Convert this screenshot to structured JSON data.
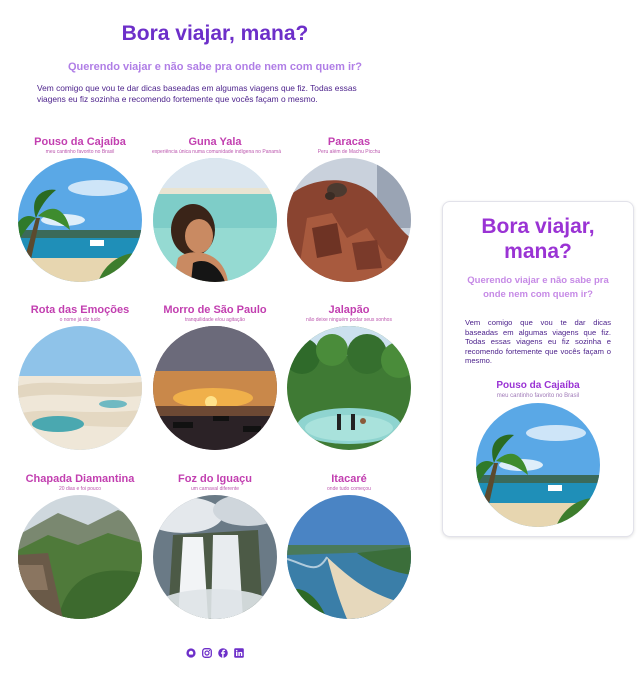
{
  "hero": {
    "title": "Bora viajar, mana?",
    "subtitle": "Querendo viajar e não sabe pra onde nem com quem ir?",
    "description": "Vem comigo que vou te dar dicas baseadas em algumas viagens que fiz. Todas essas viagens eu fiz sozinha e recomendo fortemente que vocês façam o mesmo."
  },
  "destinations": [
    {
      "name": "Pouso da Cajaíba",
      "tagline": "meu cantinho favorito no Brasil"
    },
    {
      "name": "Guna Yala",
      "tagline": "experiência única numa comunidade indígena no Panamá"
    },
    {
      "name": "Paracas",
      "tagline": "Peru além de Machu Picchu"
    },
    {
      "name": "Rota das Emoções",
      "tagline": "o nome já diz tudo"
    },
    {
      "name": "Morro de São Paulo",
      "tagline": "tranquilidade e/ou agitação"
    },
    {
      "name": "Jalapão",
      "tagline": "não deixe ninguém podar seus sonhos"
    },
    {
      "name": "Chapada Diamantina",
      "tagline": "20 dias e foi pouco"
    },
    {
      "name": "Foz do Iguaçu",
      "tagline": "um carnaval diferente"
    },
    {
      "name": "Itacaré",
      "tagline": "onde tudo começou"
    }
  ],
  "social": [
    "github-icon",
    "instagram-icon",
    "facebook-icon",
    "linkedin-icon"
  ],
  "card": {
    "title": "Bora viajar, mana?",
    "subtitle": "Querendo viajar e não sabe pra onde nem com quem ir?",
    "description": "Vem comigo que vou te dar dicas baseadas em algumas viagens que fiz. Todas essas viagens eu fiz sozinha e recomendo fortemente que vocês façam o mesmo.",
    "destination_name": "Pouso da Cajaíba",
    "destination_tagline": "meu cantinho favorito no Brasil"
  },
  "colors": {
    "title": "#6d2fc9",
    "subtitle": "#b07ee6",
    "destination": "#c23fb0"
  }
}
